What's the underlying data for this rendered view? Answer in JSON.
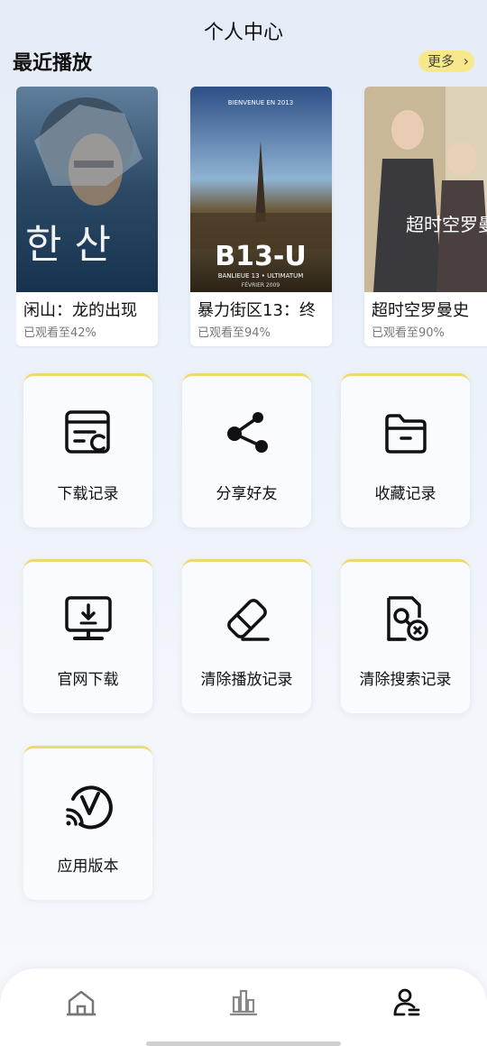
{
  "header": {
    "title": "个人中心"
  },
  "recent": {
    "title": "最近播放",
    "more_label": "更多",
    "items": [
      {
        "title": "闲山：龙的出现",
        "progress": "已观看至42%",
        "poster_text": "한 산"
      },
      {
        "title": "暴力街区13：终",
        "progress": "已观看至94%",
        "poster_text": "B13-U",
        "poster_top": "BIENVENUE EN 2013",
        "poster_sub": "BANLIEUE 13 • ULTIMATUM",
        "poster_date": "FÉVRIER 2009"
      },
      {
        "title": "超时空罗曼史",
        "progress": "已观看至90%",
        "poster_text": "超时空罗曼史"
      }
    ]
  },
  "menu": {
    "items": [
      {
        "label": "下载记录",
        "icon": "download-record-icon"
      },
      {
        "label": "分享好友",
        "icon": "share-icon"
      },
      {
        "label": "收藏记录",
        "icon": "folder-icon"
      },
      {
        "label": "官网下载",
        "icon": "monitor-download-icon"
      },
      {
        "label": "清除播放记录",
        "icon": "eraser-icon"
      },
      {
        "label": "清除搜索记录",
        "icon": "search-clear-icon"
      },
      {
        "label": "应用版本",
        "icon": "version-icon"
      }
    ]
  },
  "tabbar": {
    "tabs": [
      {
        "name": "home",
        "icon": "home-icon"
      },
      {
        "name": "ranking",
        "icon": "chart-icon"
      },
      {
        "name": "profile",
        "icon": "user-icon",
        "active": true
      }
    ]
  },
  "colors": {
    "accent": "#f2d76a",
    "more_bg": "#f7e98b"
  }
}
